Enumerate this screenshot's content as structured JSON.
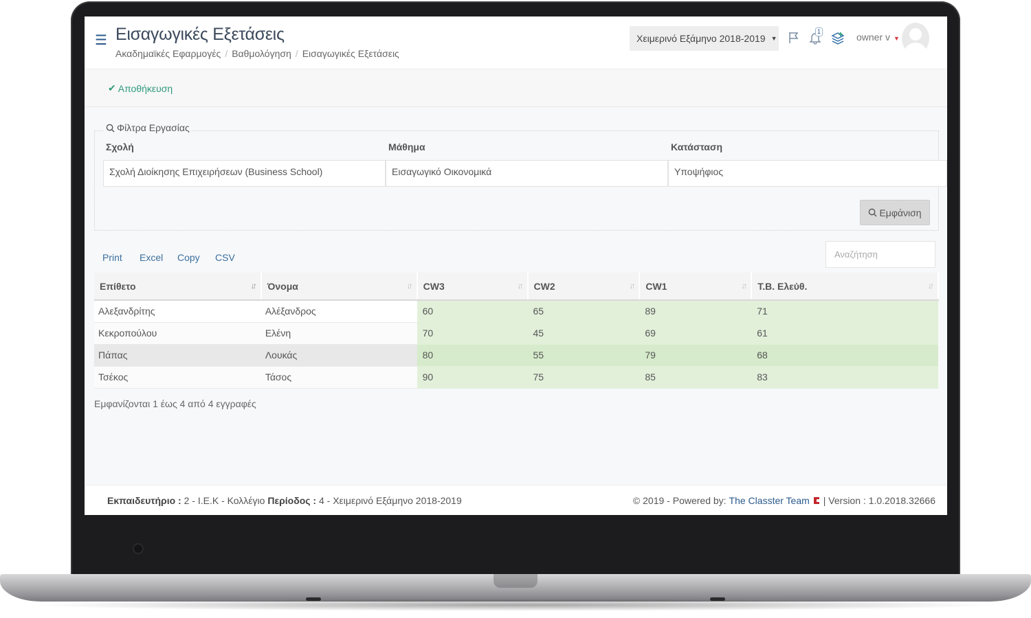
{
  "header": {
    "title": "Εισαγωγικές Εξετάσεις",
    "breadcrumb": [
      "Ακαδημαϊκές Εφαρμογές",
      "Βαθμολόγηση",
      "Εισαγωγικές Εξετάσεις"
    ],
    "semester": "Χειμερινό Εξάμηνο 2018-2019",
    "notification_count": "1",
    "user": "owner v"
  },
  "actions": {
    "save_label": "Αποθήκευση"
  },
  "filters": {
    "legend": "Φίλτρα Εργασίας",
    "school_label": "Σχολή",
    "school_value": "Σχολή Διοίκησης Επιχειρήσεων (Business School)",
    "course_label": "Μάθημα",
    "course_value": "Εισαγωγικό Οικονομικά",
    "status_label": "Κατάσταση",
    "status_value": "Υποψήφιος",
    "show_label": "Εμφάνιση"
  },
  "export": [
    "Print",
    "Excel",
    "Copy",
    "CSV"
  ],
  "search": {
    "placeholder": "Αναζήτηση"
  },
  "table": {
    "columns": [
      "Επίθετο",
      "Όνομα",
      "CW3",
      "CW2",
      "CW1",
      "Τ.Β. Ελεύθ."
    ],
    "rows": [
      [
        "Αλεξανδρίτης",
        "Αλέξανδρος",
        "60",
        "65",
        "89",
        "71"
      ],
      [
        "Κεκροπούλου",
        "Ελένη",
        "70",
        "45",
        "69",
        "61"
      ],
      [
        "Πάπας",
        "Λουκάς",
        "80",
        "55",
        "79",
        "68"
      ],
      [
        "Τσέκος",
        "Τάσος",
        "90",
        "75",
        "85",
        "83"
      ]
    ],
    "info": "Εμφανίζονται 1 έως 4 από 4 εγγραφές"
  },
  "footer": {
    "institution_label": "Εκπαιδευτήριο :",
    "institution_value": "2 - Ι.Ε.Κ - Κολλέγιο",
    "period_label": "Περίοδος :",
    "period_value": "4 - Χειμερινό Εξάμηνο 2018-2019",
    "copyright": "2019 - Powered by:",
    "team": "The Classter Team",
    "version": "| Version : 1.0.2018.32666"
  },
  "colors": {
    "accent": "#2a5a8c",
    "save": "#2f9a7c",
    "score_bg": "#e2f0da"
  }
}
